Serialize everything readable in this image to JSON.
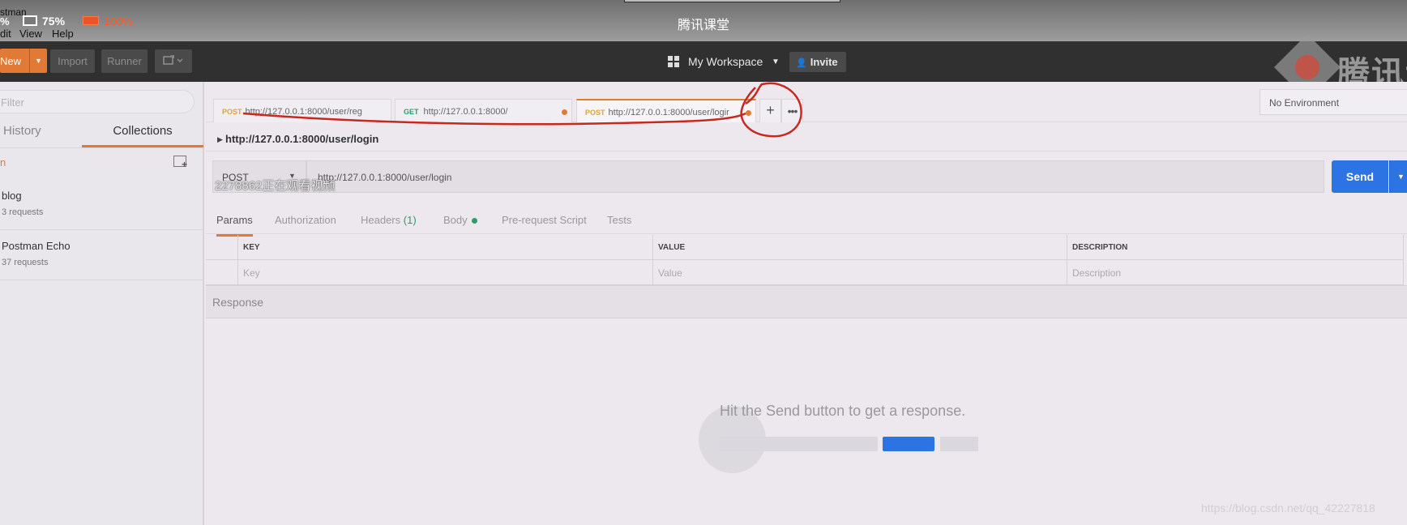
{
  "video": {
    "title": "腾讯课堂",
    "app_name": "stman",
    "zoom_a": "%",
    "zoom_b": "75%",
    "zoom_c": "100%",
    "menu": {
      "edit": "dit",
      "view": "View",
      "help": "Help"
    }
  },
  "header": {
    "new_label": "New",
    "import_label": "Import",
    "runner_label": "Runner",
    "workspace_label": "My Workspace",
    "invite_label": "Invite",
    "logo_text": "腾讯课"
  },
  "sidebar": {
    "filter_placeholder": "Filter",
    "tabs": {
      "history": "History",
      "collections": "Collections"
    },
    "orange_mark": "n",
    "collections": [
      {
        "name": "blog",
        "count": "3 requests"
      },
      {
        "name": "Postman Echo",
        "count": "37 requests"
      }
    ]
  },
  "tabs": [
    {
      "method": "POST",
      "url": "http://127.0.0.1:8000/user/reg",
      "dirty": false
    },
    {
      "method": "GET",
      "url": "http://127.0.0.1:8000/",
      "dirty": true
    },
    {
      "method": "POST",
      "url": "http://127.0.0.1:8000/user/logir",
      "dirty": true,
      "active": true
    }
  ],
  "tab_more_label": "•••",
  "environment": "No Environment",
  "request": {
    "name": "http://127.0.0.1:8000/user/login",
    "method": "POST",
    "url": "http://127.0.0.1:8000/user/login",
    "send_label": "Send",
    "viewer_overlay": "2278862正在观看视频"
  },
  "param_tabs": {
    "params": "Params",
    "authorization": "Authorization",
    "headers": "Headers",
    "headers_count": "(1)",
    "body": "Body",
    "pre_request": "Pre-request Script",
    "tests": "Tests"
  },
  "params_table": {
    "headers": [
      "KEY",
      "VALUE",
      "DESCRIPTION"
    ],
    "placeholders": [
      "Key",
      "Value",
      "Description"
    ]
  },
  "response": {
    "label": "Response",
    "empty_message": "Hit the Send button to get a response."
  },
  "watermark": "https://blog.csdn.net/qq_42227818",
  "colors": {
    "accent": "#e07a35",
    "send": "#2c73e3",
    "annotation": "#c8281e"
  }
}
